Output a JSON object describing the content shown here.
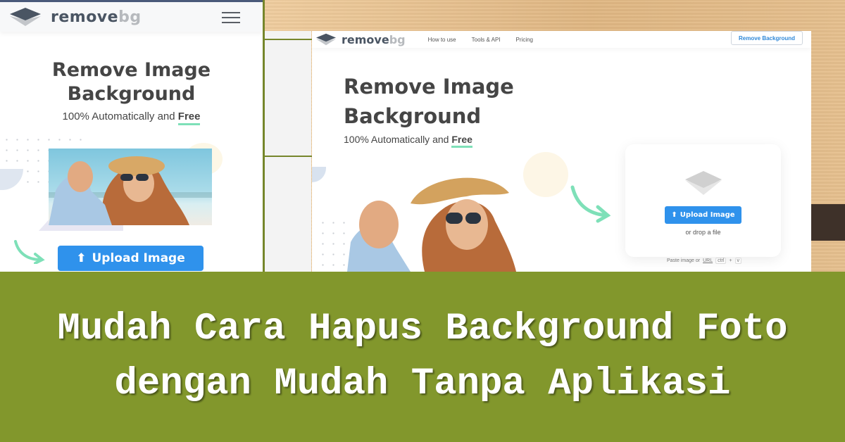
{
  "mobile": {
    "logo": {
      "main": "remove",
      "suffix": "bg"
    },
    "menu_icon": "hamburger-icon",
    "title_line1": "Remove Image",
    "title_line2": "Background",
    "subtitle_prefix": "100% Automatically and ",
    "subtitle_free": "Free",
    "upload_button": "Upload Image"
  },
  "desktop": {
    "logo": {
      "main": "remove",
      "suffix": "bg"
    },
    "nav": [
      "How to use",
      "Tools & API",
      "Pricing"
    ],
    "header_button": "Remove Background",
    "title_line1": "Remove Image",
    "title_line2": "Background",
    "subtitle_prefix": "100% Automatically and ",
    "subtitle_free": "Free",
    "upload_button": "Upload Image",
    "drop_text": "or drop a file",
    "paste_text": "Paste image or ",
    "paste_url": "URL",
    "shortcut": [
      "ctrl",
      "+",
      "v"
    ]
  },
  "banner": {
    "title": "Mudah Cara Hapus Background Foto dengan Mudah Tanpa Aplikasi"
  },
  "colors": {
    "accent_blue": "#2f92ec",
    "free_underline": "#7ee0b8",
    "banner_green": "#82972c",
    "heading": "#454545"
  }
}
